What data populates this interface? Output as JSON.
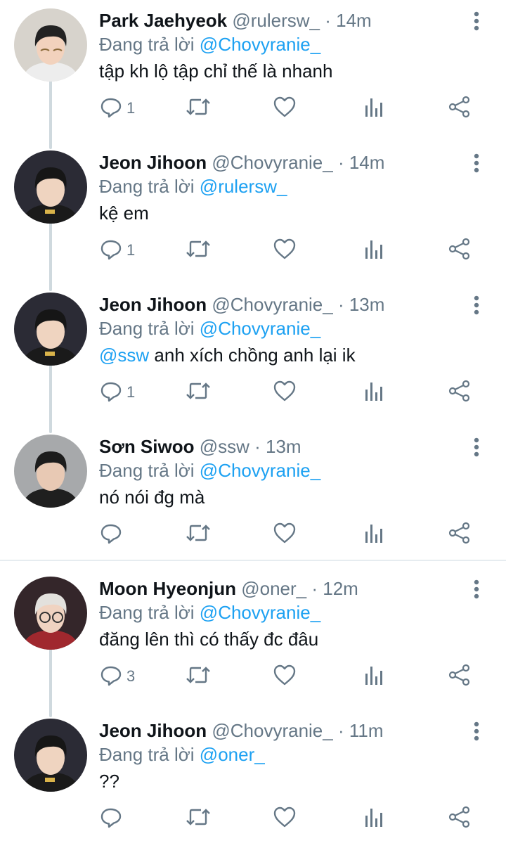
{
  "reply_prefix": "Đang trả lời",
  "tweets": [
    {
      "name": "Park Jaehyeok",
      "handle": "@rulersw_",
      "time": "14m",
      "reply_to": "@Chovyranie_",
      "text_pre": "",
      "text_mention": "",
      "text": "tập kh lộ tập chỉ thế là nhanh",
      "reply_count": "1",
      "avatar": "ruler"
    },
    {
      "name": "Jeon Jihoon",
      "handle": "@Chovyranie_",
      "time": "14m",
      "reply_to": "@rulersw_",
      "text_pre": "",
      "text_mention": "",
      "text": "kệ em",
      "reply_count": "1",
      "avatar": "chovy"
    },
    {
      "name": "Jeon Jihoon",
      "handle": "@Chovyranie_",
      "time": "13m",
      "reply_to": "@Chovyranie_",
      "text_mention": "@ssw",
      "text": " anh xích chồng anh lại ik",
      "reply_count": "1",
      "avatar": "chovy"
    },
    {
      "name": "Sơn Siwoo",
      "handle": "@ssw",
      "time": "13m",
      "reply_to": "@Chovyranie_",
      "text_mention": "",
      "text": "nó nói đg mà",
      "reply_count": "",
      "avatar": "siwoo"
    },
    {
      "name": "Moon Hyeonjun",
      "handle": "@oner_",
      "time": "12m",
      "reply_to": "@Chovyranie_",
      "text_mention": "",
      "text": "đăng lên thì có thấy đc đâu",
      "reply_count": "3",
      "avatar": "oner"
    },
    {
      "name": "Jeon Jihoon",
      "handle": "@Chovyranie_",
      "time": "11m",
      "reply_to": "@oner_",
      "text_mention": "",
      "text": "??",
      "reply_count": "",
      "avatar": "chovy"
    }
  ],
  "icons": [
    "more-icon",
    "reply-icon",
    "retweet-icon",
    "like-icon",
    "analytics-icon",
    "share-icon"
  ],
  "colors": {
    "mention": "#1da1f2",
    "muted": "#657786",
    "thread_line": "#cfd9de"
  }
}
